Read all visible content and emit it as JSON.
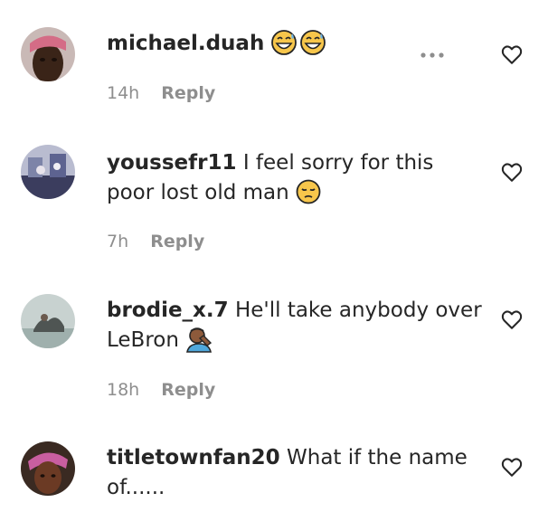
{
  "comments": [
    {
      "username": "michael.duah",
      "text": "",
      "emoji": "grinning-sweat-face",
      "time": "14h",
      "reply_label": "Reply",
      "avatar_colors": [
        "#d46c86",
        "#3a2418"
      ]
    },
    {
      "username": "youssefr11",
      "text": "I feel sorry for this poor lost old man",
      "emoji": "pensive-face",
      "time": "7h",
      "reply_label": "Reply",
      "avatar_colors": [
        "#7d84a8",
        "#3b3d5e"
      ]
    },
    {
      "username": "brodie_x.7",
      "text": "He'll take anybody over LeBron",
      "emoji": "facepalm",
      "time": "18h",
      "reply_label": "Reply",
      "avatar_colors": [
        "#9fb0ad",
        "#4f5553"
      ]
    },
    {
      "username": "titletownfan20",
      "text": "What if the name of......",
      "emoji": "",
      "time": "",
      "reply_label": "",
      "avatar_colors": [
        "#c95ea0",
        "#6b3a24"
      ]
    }
  ],
  "icons": {
    "like": "heart-outline-icon",
    "more": "more-dots-icon"
  },
  "colors": {
    "text": "#262626",
    "secondary": "#8e8e8e",
    "emoji_yellow": "#f7c64b"
  }
}
